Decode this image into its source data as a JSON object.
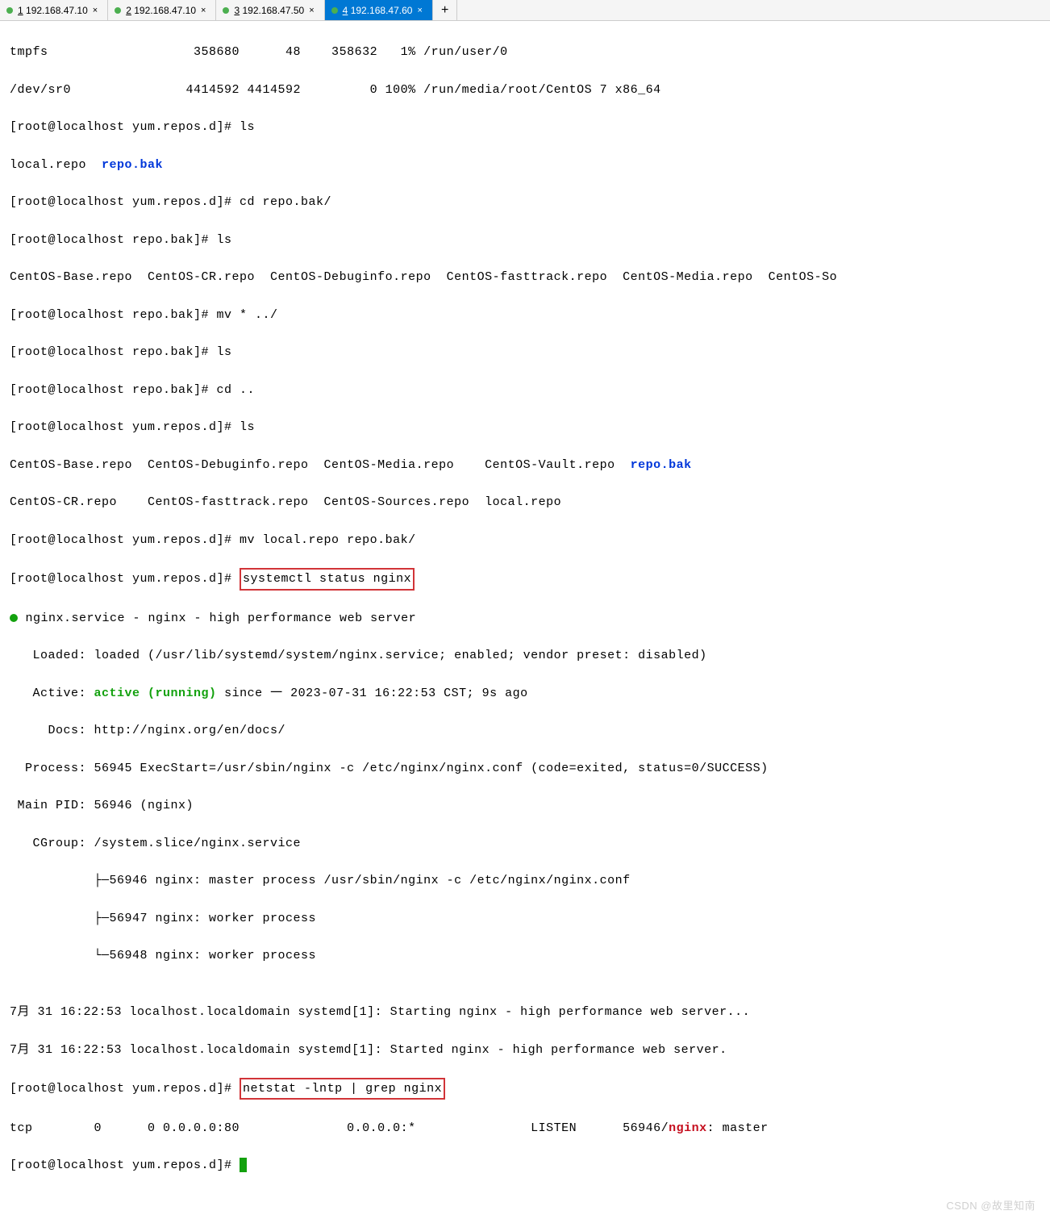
{
  "tabs": [
    {
      "num": "1",
      "label": "192.168.47.10",
      "close": "×"
    },
    {
      "num": "2",
      "label": "192.168.47.10",
      "close": "×"
    },
    {
      "num": "3",
      "label": "192.168.47.50",
      "close": "×"
    },
    {
      "num": "4",
      "label": "192.168.47.60",
      "close": "×"
    }
  ],
  "new_tab": "+",
  "terminal": {
    "l1": "tmpfs                   358680      48    358632   1% /run/user/0",
    "l2": "/dev/sr0               4414592 4414592         0 100% /run/media/root/CentOS 7 x86_64",
    "l3": "[root@localhost yum.repos.d]# ls",
    "l4a": "local.repo  ",
    "l4b": "repo.bak",
    "l5": "[root@localhost yum.repos.d]# cd repo.bak/",
    "l6": "[root@localhost repo.bak]# ls",
    "l7": "CentOS-Base.repo  CentOS-CR.repo  CentOS-Debuginfo.repo  CentOS-fasttrack.repo  CentOS-Media.repo  CentOS-So",
    "l8": "[root@localhost repo.bak]# mv * ../",
    "l9": "[root@localhost repo.bak]# ls",
    "l10": "[root@localhost repo.bak]# cd ..",
    "l11": "[root@localhost yum.repos.d]# ls",
    "l12a": "CentOS-Base.repo  CentOS-Debuginfo.repo  CentOS-Media.repo    CentOS-Vault.repo  ",
    "l12b": "repo.bak",
    "l13": "CentOS-CR.repo    CentOS-fasttrack.repo  CentOS-Sources.repo  local.repo",
    "l14": "[root@localhost yum.repos.d]# mv local.repo repo.bak/",
    "l15a": "[root@localhost yum.repos.d]# ",
    "l15b": "systemctl status nginx",
    "l16": " nginx.service - nginx - high performance web server",
    "l17": "   Loaded: loaded (/usr/lib/systemd/system/nginx.service; enabled; vendor preset: disabled)",
    "l18a": "   Active: ",
    "l18b": "active (running)",
    "l18c": " since 一 2023-07-31 16:22:53 CST; 9s ago",
    "l19": "     Docs: http://nginx.org/en/docs/",
    "l20": "  Process: 56945 ExecStart=/usr/sbin/nginx -c /etc/nginx/nginx.conf (code=exited, status=0/SUCCESS)",
    "l21": " Main PID: 56946 (nginx)",
    "l22": "   CGroup: /system.slice/nginx.service",
    "l23": "           ├─56946 nginx: master process /usr/sbin/nginx -c /etc/nginx/nginx.conf",
    "l24": "           ├─56947 nginx: worker process",
    "l25": "           └─56948 nginx: worker process",
    "l26": "",
    "l27": "7月 31 16:22:53 localhost.localdomain systemd[1]: Starting nginx - high performance web server...",
    "l28": "7月 31 16:22:53 localhost.localdomain systemd[1]: Started nginx - high performance web server.",
    "l29a": "[root@localhost yum.repos.d]# ",
    "l29b": "netstat -lntp | grep nginx",
    "l30a": "tcp        0      0 0.0.0.0:80              0.0.0.0:*               LISTEN      56946/",
    "l30b": "nginx",
    "l30c": ": master ",
    "l31": "[root@localhost yum.repos.d]# "
  },
  "watermark": "CSDN @故里知南"
}
